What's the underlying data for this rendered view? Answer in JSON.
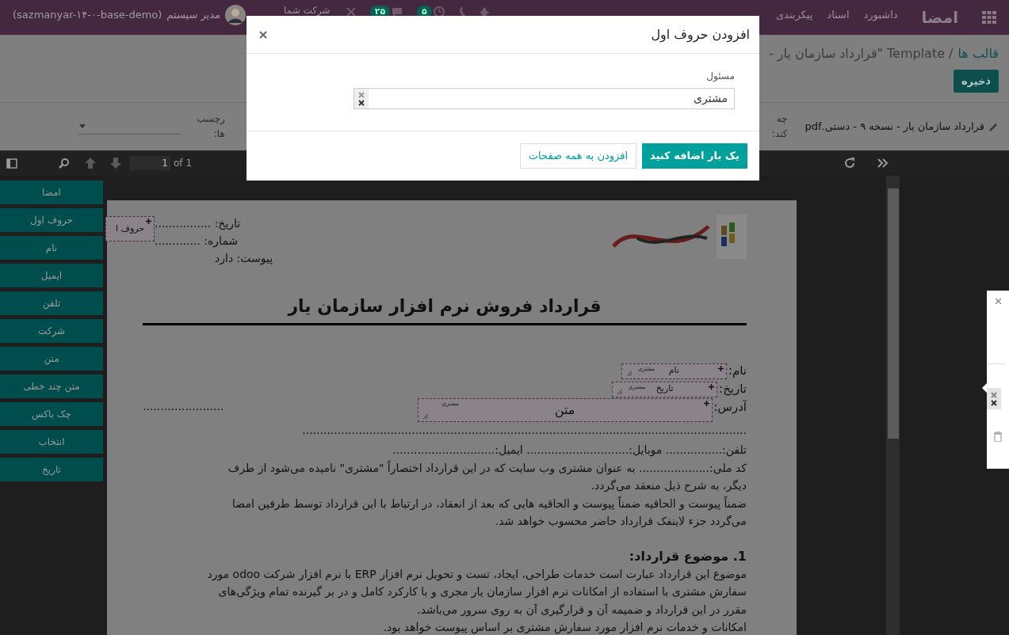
{
  "top_bar": {
    "brand": "امضا",
    "menu": [
      {
        "label": "داشبورد"
      },
      {
        "label": "اسناد"
      },
      {
        "label": "پیکربندی"
      }
    ],
    "activity_count": "۵",
    "message_count": "۲۵",
    "company": "شرکت شما",
    "user": {
      "name": "مدیر سیستم",
      "database": "(sazmanyar-۱۴-۰-base-demo)"
    }
  },
  "control_panel": {
    "breadcrumb": [
      {
        "label": "قالب ها"
      },
      {
        "label": "/ Template \"قرارداد سازمان یار -"
      }
    ],
    "save_button": "ذخیره"
  },
  "fields": {
    "attachment": "قرارداد سازمان یار - نسخه ۹ - دستی.pdf",
    "label_1": [
      "چه",
      "کند:"
    ],
    "tags_label": [
      "رچسب",
      "ها:"
    ]
  },
  "pdf_toolbar": {
    "page": "1",
    "page_count": "of 1"
  },
  "signature_items": [
    {
      "label": "امضا"
    },
    {
      "label": "حروف اول"
    },
    {
      "label": "نام"
    },
    {
      "label": "ایمیل"
    },
    {
      "label": "تلفن"
    },
    {
      "label": "شرکت"
    },
    {
      "label": "متن"
    },
    {
      "label": "متن چند خطی"
    },
    {
      "label": "چک باکس"
    },
    {
      "label": "انتخاب"
    },
    {
      "label": "تاریخ"
    }
  ],
  "document": {
    "corner_field": {
      "name": "حروف ا"
    },
    "header_lines": [
      "تاریخ: ................",
      "شماره: .............",
      "پیوست: دارد"
    ],
    "title": "قرارداد فروش نرم افزار سازمان یار",
    "form_lines": [
      {
        "label": "نام:",
        "field": {
          "name": "نام",
          "role": "مشتری"
        }
      },
      {
        "label": "تاریخ:",
        "field": {
          "name": "تاریخ",
          "role": "مشتری"
        }
      },
      {
        "label": "آدرس:",
        "field": {
          "name": "متن",
          "role": "مشتری"
        },
        "trailing": "......................."
      }
    ],
    "dotted_line": "..............................................................................................................................",
    "body": [
      {
        "kind": "line",
        "text": "تلفن:................ موبایل:............................. ایمیل:............................."
      },
      {
        "kind": "line",
        "text": "کد ملی:.................... به عنوان مشتری وب سایت که در این قرارداد اختصاراً \"مشتری\" نامیده می‌شود از طرف"
      },
      {
        "kind": "line",
        "text": "دیگر، به شرح ذیل منعقد می‌گردد."
      },
      {
        "kind": "line",
        "text": "ضمناً پیوست و الحاقیه ضمناً پیوست و الحاقیه هایی که بعد از انعقاد، در ارتباط با این قرارداد توسط طرفین امضا"
      },
      {
        "kind": "line",
        "text": "می‌گردد جزء لاینفک قرارداد حاضر محسوب خواهد شد."
      },
      {
        "kind": "heading",
        "text": "1. موضوع قرارداد:"
      },
      {
        "kind": "line",
        "text": "موضوع این قرارداد عبارت است خدمات طراحی، ایجاد، تست و تحویل نرم افزار ERP با نرم افزار شرکت odoo مورد"
      },
      {
        "kind": "line",
        "text": "سفارش مشتری با استفاده از امکانات نرم افزار سازمان یار مجری و با کارکرد کامل و در بر گیرنده تمام ویژگی‌های"
      },
      {
        "kind": "line",
        "text": "مقرر در این قرارداد و ضمیمه آن و قرارگیری آن به روی سرور می‌باشد."
      },
      {
        "kind": "line",
        "text": "امکانات و خدمات نرم افزار مورد سفارش مشتری بر اساس پیوست خواهد بود."
      }
    ]
  },
  "dialog": {
    "title": "افزودن حروف اول",
    "field_label": "مسئول",
    "field_value": "مشتری",
    "buttons": [
      {
        "label": "یک بار اضافه کنید",
        "kind": "primary"
      },
      {
        "label": "افزودن به همه صفحات",
        "kind": "secondary"
      }
    ]
  }
}
